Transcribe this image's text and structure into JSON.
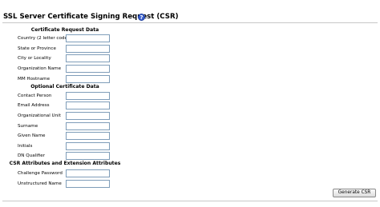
{
  "page": {
    "title": "SSL Server Certificate Signing Request (CSR)",
    "help_icon_glyph": "?"
  },
  "sections": [
    {
      "header": "Certificate Request Data",
      "fields": [
        {
          "label": "Country (2 letter code)",
          "value": ""
        },
        {
          "label": "State or Province",
          "value": ""
        },
        {
          "label": "City or Locality",
          "value": ""
        },
        {
          "label": "Organization Name",
          "value": ""
        },
        {
          "label": "MM Hostname",
          "value": ""
        }
      ]
    },
    {
      "header": "Optional Certificate Data",
      "fields": [
        {
          "label": "Contact Person",
          "value": ""
        },
        {
          "label": "Email Address",
          "value": ""
        },
        {
          "label": "Organizational Unit",
          "value": ""
        },
        {
          "label": "Surname",
          "value": ""
        },
        {
          "label": "Given Name",
          "value": ""
        },
        {
          "label": "Initials",
          "value": ""
        },
        {
          "label": "DN Qualifier",
          "value": ""
        }
      ]
    },
    {
      "header": "CSR Attributes and Extension Attributes",
      "fields": [
        {
          "label": "Challenge Password",
          "value": ""
        },
        {
          "label": "Unstructured Name",
          "value": ""
        }
      ]
    }
  ],
  "actions": {
    "generate_label": "Generate CSR"
  },
  "colors": {
    "help_icon": "#3a5fcd",
    "input_border": "#7f9db9",
    "rule": "#c8c8c8"
  }
}
